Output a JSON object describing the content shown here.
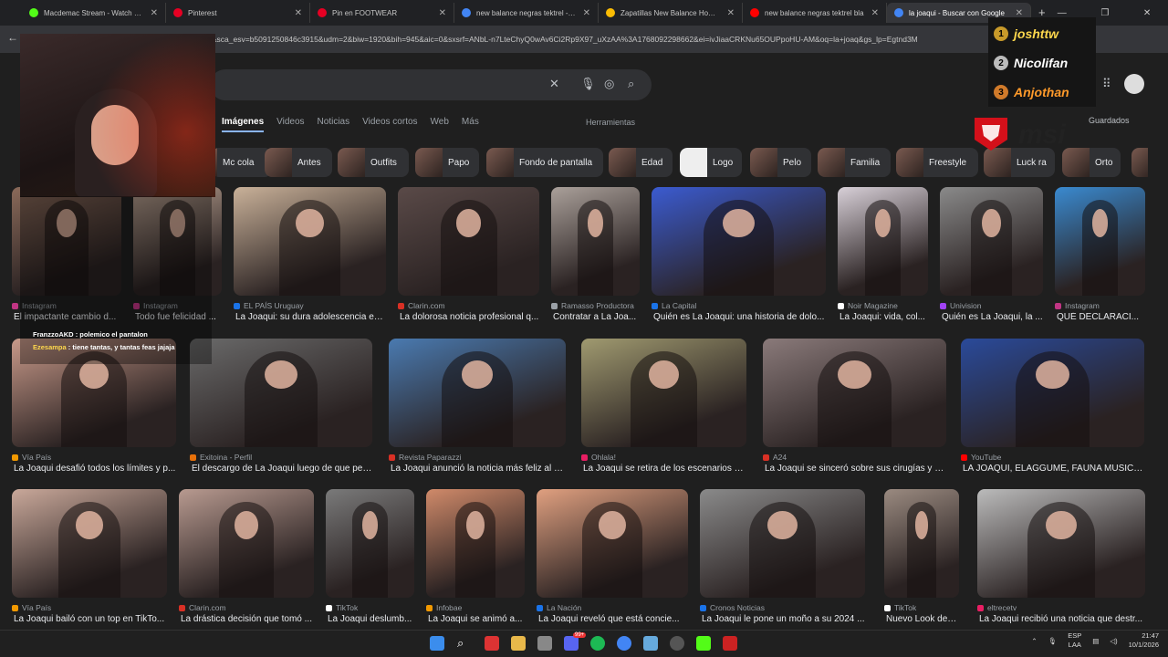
{
  "browser": {
    "tabs": [
      {
        "title": "Macdemac Stream - Watch Live",
        "color": "#53fc18"
      },
      {
        "title": "Pinterest",
        "color": "#e60023"
      },
      {
        "title": "Pin en FOOTWEAR",
        "color": "#e60023"
      },
      {
        "title": "new balance negras tektrel - Bu",
        "color": "#4285f4"
      },
      {
        "title": "Zapatillas New Balance Hombre",
        "color": "#fbbc04"
      },
      {
        "title": "new balance negras tektrel bla",
        "color": "#ff0000"
      },
      {
        "title": "la joaqui - Buscar con Google",
        "color": "#4285f4"
      }
    ],
    "url": "i&sca_esv=b5091250846c3915&udm=2&biw=1920&bih=945&aic=0&sxsrf=ANbL-n7LteChyQ0wAv6Ci2Rp9X97_uXzAA%3A1768092298662&ei=ivJiaaCRKNu65OUPpoHU-AM&oq=la+joaq&gs_lp=Egtnd3M"
  },
  "search": {
    "tabs": [
      "Imágenes",
      "Videos",
      "Noticias",
      "Videos cortos",
      "Web",
      "Más"
    ],
    "tools": "Herramientas",
    "saved": "Guardados"
  },
  "chips": [
    "Mc cola",
    "Antes",
    "Outfits",
    "Papo",
    "Fondo de pantalla",
    "Edad",
    "Logo",
    "Pelo",
    "Familia",
    "Freestyle",
    "Luck ra",
    "Orto"
  ],
  "results": [
    {
      "source": "Instagram",
      "caption": "El impactante cambio d...",
      "color": "#c13584"
    },
    {
      "source": "Instagram",
      "caption": "Todo fue felicidad ...",
      "color": "#c13584"
    },
    {
      "source": "EL PAÍS Uruguay",
      "caption": "La Joaqui: su dura adolescencia en...",
      "color": "#1a73e8"
    },
    {
      "source": "Clarin.com",
      "caption": "La dolorosa noticia profesional q...",
      "color": "#d93025"
    },
    {
      "source": "Ramasso Productora",
      "caption": "Contratar a La Joa...",
      "color": "#9aa0a6"
    },
    {
      "source": "La Capital",
      "caption": "Quién es La Joaqui: una historia de dolo...",
      "color": "#1a73e8"
    },
    {
      "source": "Noir Magazine",
      "caption": "La Joaqui: vida, col...",
      "color": "#ffffff"
    },
    {
      "source": "Univision",
      "caption": "Quién es La Joaqui, la ...",
      "color": "#a142f4"
    },
    {
      "source": "Instagram",
      "caption": "QUÉ DECLARACI...",
      "color": "#c13584"
    },
    {
      "source": "Vía País",
      "caption": "La Joaqui desafió todos los límites y p...",
      "color": "#f29900"
    },
    {
      "source": "Exitoina - Perfil",
      "caption": "El descargo de La Joaqui luego de que perd...",
      "color": "#e8710a"
    },
    {
      "source": "Revista Paparazzi",
      "caption": "La Joaqui anunció la noticia más feliz al c...",
      "color": "#d93025"
    },
    {
      "source": "Ohlala!",
      "caption": "La Joaqui se retira de los escenarios y ...",
      "color": "#e91e63"
    },
    {
      "source": "A24",
      "caption": "La Joaqui se sinceró sobre sus cirugías y m...",
      "color": "#d93025"
    },
    {
      "source": "YouTube",
      "caption": "LA JOAQUI, ELAGGUME, FAUNA MUSIC, ...",
      "color": "#ff0000"
    },
    {
      "source": "Vía País",
      "caption": "La Joaqui bailó con un top en TikTo...",
      "color": "#f29900"
    },
    {
      "source": "Clarin.com",
      "caption": "La drástica decisión que tomó ...",
      "color": "#d93025"
    },
    {
      "source": "TikTok",
      "caption": "La Joaqui deslumb...",
      "color": "#ffffff"
    },
    {
      "source": "Infobae",
      "caption": "La Joaqui se animó a...",
      "color": "#f29900"
    },
    {
      "source": "La Nación",
      "caption": "La Joaqui reveló que está concie...",
      "color": "#1a73e8"
    },
    {
      "source": "Cronos Noticias",
      "caption": "La Joaqui le pone un moño a su 2024 ...",
      "color": "#1a73e8"
    },
    {
      "source": "TikTok",
      "caption": "Nuevo Look de La ...",
      "color": "#ffffff"
    },
    {
      "source": "eltrecetv",
      "caption": "La Joaqui recibió una noticia que destr...",
      "color": "#e91e63"
    }
  ],
  "overlay": {
    "chat": [
      {
        "user": "FranzzoAKD",
        "text": ": polemico el pantalon"
      },
      {
        "user": "Ezesampa",
        "text": ": tiene tantas, y tantas feas jajaja"
      }
    ],
    "leaderboard": [
      {
        "rank": "1",
        "name": "joshttw"
      },
      {
        "rank": "2",
        "name": "Nicolifan"
      },
      {
        "rank": "3",
        "name": "Anjothan"
      }
    ],
    "logo": "msi"
  },
  "taskbar": {
    "lang": "ESP",
    "lang2": "LAA",
    "time": "21:47",
    "date": "10/1/2026",
    "badge": "99+"
  }
}
